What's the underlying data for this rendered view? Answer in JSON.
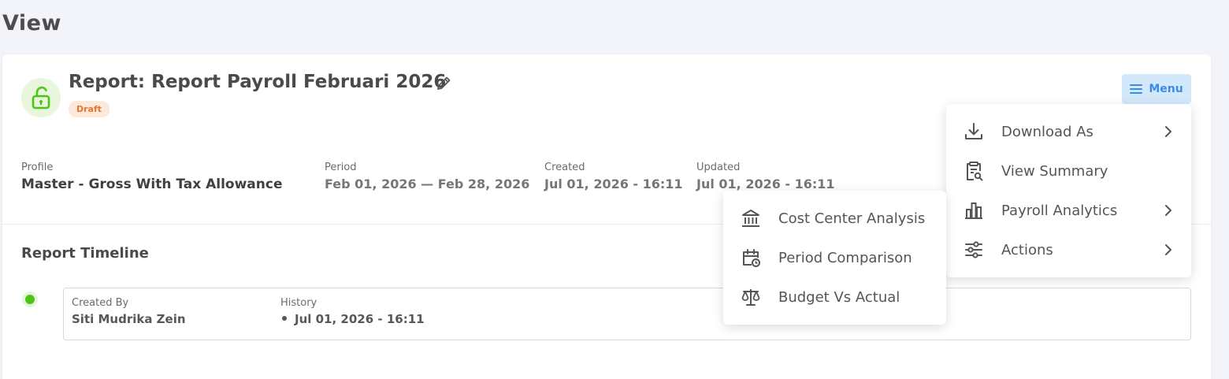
{
  "page": {
    "title": "View"
  },
  "report": {
    "title": "Report: Report Payroll Februari 2026",
    "status": "Draft",
    "status_color": "#e8772d"
  },
  "meta": {
    "profile_label": "Profile",
    "profile_value": "Master - Gross With Tax Allowance",
    "period_label": "Period",
    "period_value": "Feb 01, 2026 — Feb 28, 2026",
    "created_label": "Created",
    "created_value": "Jul 01, 2026 - 16:11",
    "updated_label": "Updated",
    "updated_value": "Jul 01, 2026 - 16:11"
  },
  "timeline": {
    "title": "Report Timeline",
    "entries": [
      {
        "created_by_label": "Created By",
        "created_by": "Siti Mudrika Zein",
        "history_label": "History",
        "history": [
          "Jul 01, 2026 - 16:11"
        ]
      }
    ]
  },
  "menu": {
    "button_label": "Menu",
    "items": [
      {
        "label": "Download As",
        "icon": "download-icon",
        "has_submenu": true
      },
      {
        "label": "View Summary",
        "icon": "clipboard-search-icon",
        "has_submenu": false
      },
      {
        "label": "Payroll Analytics",
        "icon": "bar-chart-icon",
        "has_submenu": true
      },
      {
        "label": "Actions",
        "icon": "sliders-icon",
        "has_submenu": true
      }
    ],
    "submenu": [
      {
        "label": "Cost Center Analysis",
        "icon": "bank-icon"
      },
      {
        "label": "Period Comparison",
        "icon": "calendar-clock-icon"
      },
      {
        "label": "Budget Vs Actual",
        "icon": "scale-icon"
      }
    ]
  },
  "colors": {
    "accent": "#3a8de6",
    "success": "#4cc51b",
    "menu_bg": "#d4e8fb"
  }
}
